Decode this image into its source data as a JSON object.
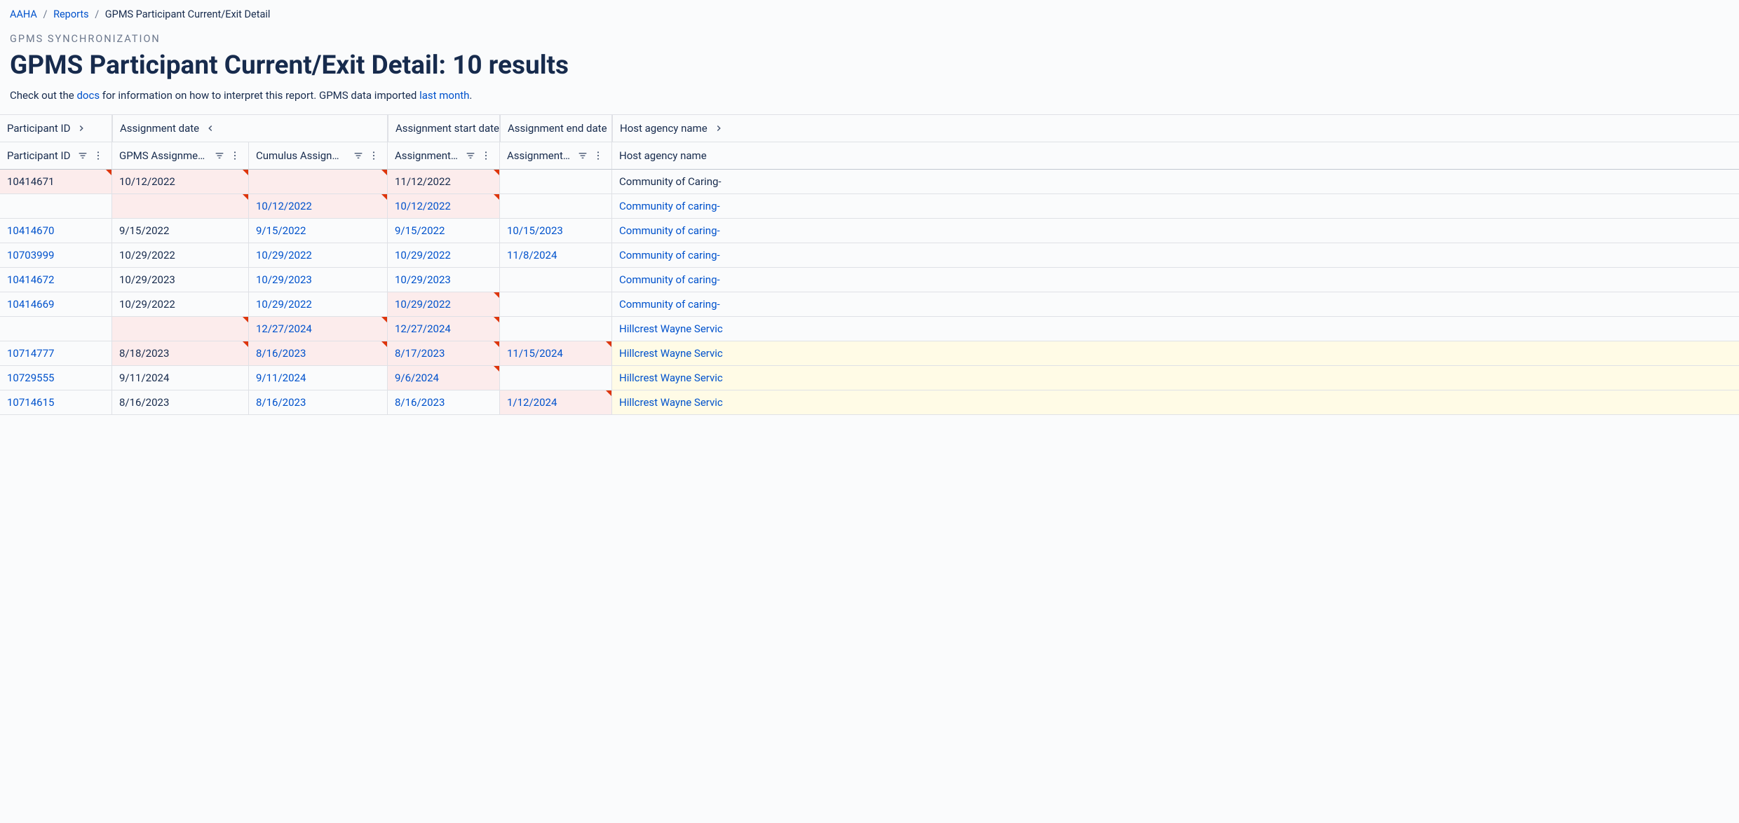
{
  "breadcrumb": {
    "root": "AAHA",
    "section": "Reports",
    "current": "GPMS Participant Current/Exit Detail"
  },
  "eyebrow": "GPMS SYNCHRONIZATION",
  "title": "GPMS Participant Current/Exit Detail: 10 results",
  "subtitle": {
    "pre": "Check out the ",
    "docs": "docs",
    "mid": " for information on how to interpret this report. GPMS data imported ",
    "lastmonth": "last month",
    "post": "."
  },
  "groupHeaders": {
    "pid": "Participant ID",
    "assign": "Assignment date",
    "start": "Assignment start date",
    "end": "Assignment end date",
    "host": "Host agency name"
  },
  "subHeaders": {
    "pid": "Participant ID",
    "gad": "GPMS Assignment date",
    "cad": "Cumulus Assignment date",
    "start": "Assignment start d…",
    "end": "Assignment end d…",
    "host": "Host agency name"
  },
  "rows": [
    {
      "pid": "10414671",
      "pidLink": false,
      "gad": "10/12/2022",
      "cad": "",
      "start": "11/12/2022",
      "end": "",
      "host": "Community of Caring-",
      "linkCols": [],
      "plainCols": [
        "pid",
        "gad",
        "start",
        "host"
      ],
      "hl": [
        "pid",
        "gad",
        "cad",
        "start"
      ],
      "flags": [
        "pid",
        "gad",
        "cad",
        "start"
      ],
      "yellow": []
    },
    {
      "pid": "",
      "pidLink": false,
      "gad": "",
      "cad": "10/12/2022",
      "start": "10/12/2022",
      "end": "",
      "host": "Community of caring-",
      "linkCols": [
        "cad",
        "start",
        "host"
      ],
      "plainCols": [],
      "hl": [
        "gad",
        "cad",
        "start"
      ],
      "flags": [
        "gad",
        "cad",
        "start"
      ],
      "yellow": []
    },
    {
      "pid": "10414670",
      "pidLink": true,
      "gad": "9/15/2022",
      "cad": "9/15/2022",
      "start": "9/15/2022",
      "end": "10/15/2023",
      "host": "Community of caring-",
      "linkCols": [
        "pid",
        "cad",
        "start",
        "end",
        "host"
      ],
      "plainCols": [
        "gad"
      ],
      "hl": [],
      "flags": [],
      "yellow": []
    },
    {
      "pid": "10703999",
      "pidLink": true,
      "gad": "10/29/2022",
      "cad": "10/29/2022",
      "start": "10/29/2022",
      "end": "11/8/2024",
      "host": "Community of caring-",
      "linkCols": [
        "pid",
        "cad",
        "start",
        "end",
        "host"
      ],
      "plainCols": [
        "gad"
      ],
      "hl": [],
      "flags": [],
      "yellow": []
    },
    {
      "pid": "10414672",
      "pidLink": true,
      "gad": "10/29/2023",
      "cad": "10/29/2023",
      "start": "10/29/2023",
      "end": "",
      "host": "Community of caring-",
      "linkCols": [
        "pid",
        "cad",
        "start",
        "host"
      ],
      "plainCols": [
        "gad"
      ],
      "hl": [],
      "flags": [],
      "yellow": []
    },
    {
      "pid": "10414669",
      "pidLink": true,
      "gad": "10/29/2022",
      "cad": "10/29/2022",
      "start": "10/29/2022",
      "end": "",
      "host": "Community of caring-",
      "linkCols": [
        "pid",
        "cad",
        "start",
        "host"
      ],
      "plainCols": [
        "gad"
      ],
      "hl": [
        "start"
      ],
      "flags": [
        "start"
      ],
      "yellow": []
    },
    {
      "pid": "",
      "pidLink": false,
      "gad": "",
      "cad": "12/27/2024",
      "start": "12/27/2024",
      "end": "",
      "host": "Hillcrest Wayne Servic",
      "linkCols": [
        "cad",
        "start",
        "host"
      ],
      "plainCols": [],
      "hl": [
        "gad",
        "cad",
        "start"
      ],
      "flags": [
        "gad",
        "cad",
        "start"
      ],
      "yellow": []
    },
    {
      "pid": "10714777",
      "pidLink": true,
      "gad": "8/18/2023",
      "cad": "8/16/2023",
      "start": "8/17/2023",
      "end": "11/15/2024",
      "host": "Hillcrest Wayne Servic",
      "linkCols": [
        "pid",
        "cad",
        "start",
        "end",
        "host"
      ],
      "plainCols": [
        "gad"
      ],
      "hl": [
        "gad",
        "cad",
        "start",
        "end"
      ],
      "flags": [
        "gad",
        "cad",
        "start",
        "end"
      ],
      "yellow": [
        "host"
      ]
    },
    {
      "pid": "10729555",
      "pidLink": true,
      "gad": "9/11/2024",
      "cad": "9/11/2024",
      "start": "9/6/2024",
      "end": "",
      "host": "Hillcrest Wayne Servic",
      "linkCols": [
        "pid",
        "cad",
        "start",
        "host"
      ],
      "plainCols": [
        "gad"
      ],
      "hl": [
        "start"
      ],
      "flags": [
        "start"
      ],
      "yellow": [
        "host"
      ]
    },
    {
      "pid": "10714615",
      "pidLink": true,
      "gad": "8/16/2023",
      "cad": "8/16/2023",
      "start": "8/16/2023",
      "end": "1/12/2024",
      "host": "Hillcrest Wayne Servic",
      "linkCols": [
        "pid",
        "cad",
        "start",
        "end",
        "host"
      ],
      "plainCols": [
        "gad"
      ],
      "hl": [
        "end"
      ],
      "flags": [
        "end"
      ],
      "yellow": [
        "host"
      ]
    }
  ]
}
